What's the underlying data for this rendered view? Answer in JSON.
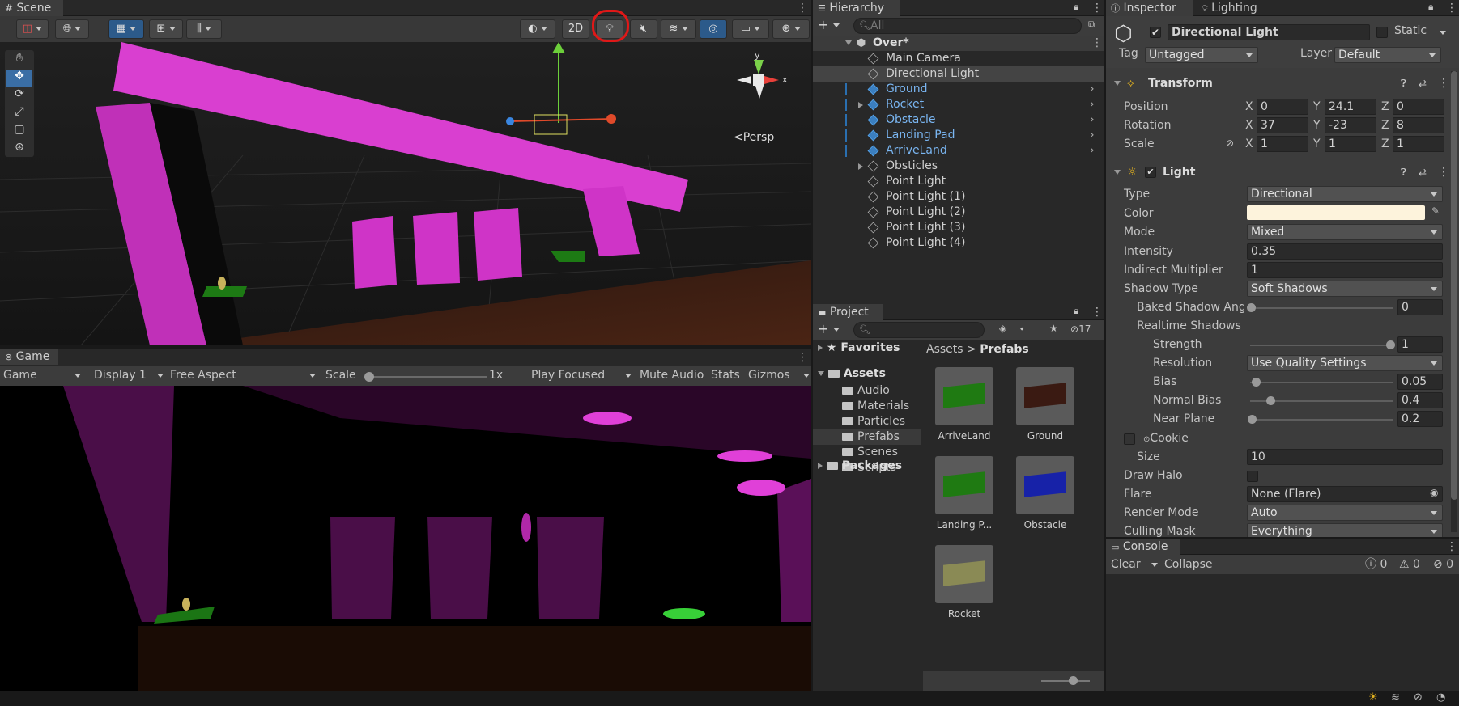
{
  "scene": {
    "tab": "Scene",
    "toolbar": {
      "btn_2d": "2D"
    },
    "gizmo": {
      "y": "y",
      "x": "x",
      "persp": "<Persp"
    }
  },
  "game": {
    "tab": "Game",
    "display_mode": "Game",
    "display": "Display 1",
    "aspect": "Free Aspect",
    "scale_label": "Scale",
    "scale_value": "1x",
    "play_mode": "Play Focused",
    "mute": "Mute Audio",
    "stats": "Stats",
    "gizmos": "Gizmos"
  },
  "hierarchy": {
    "tab": "Hierarchy",
    "search_placeholder": "All",
    "scene_name": "Over*",
    "items": [
      {
        "label": "Main Camera",
        "prefab": false,
        "expandable": false,
        "arrow": false
      },
      {
        "label": "Directional Light",
        "prefab": false,
        "expandable": false,
        "arrow": false,
        "selected": true
      },
      {
        "label": "Ground",
        "prefab": true,
        "expandable": false,
        "arrow": true
      },
      {
        "label": "Rocket",
        "prefab": true,
        "expandable": true,
        "arrow": true
      },
      {
        "label": "Obstacle",
        "prefab": true,
        "expandable": false,
        "arrow": true
      },
      {
        "label": "Landing Pad",
        "prefab": true,
        "expandable": false,
        "arrow": true
      },
      {
        "label": "ArriveLand",
        "prefab": true,
        "expandable": false,
        "arrow": true
      },
      {
        "label": "Obsticles",
        "prefab": false,
        "expandable": true,
        "arrow": false
      },
      {
        "label": "Point Light",
        "prefab": false,
        "expandable": false,
        "arrow": false
      },
      {
        "label": "Point Light (1)",
        "prefab": false,
        "expandable": false,
        "arrow": false
      },
      {
        "label": "Point Light (2)",
        "prefab": false,
        "expandable": false,
        "arrow": false
      },
      {
        "label": "Point Light (3)",
        "prefab": false,
        "expandable": false,
        "arrow": false
      },
      {
        "label": "Point Light (4)",
        "prefab": false,
        "expandable": false,
        "arrow": false
      }
    ]
  },
  "project": {
    "tab": "Project",
    "hidden_count": "17",
    "favorites": "Favorites",
    "assets": "Assets",
    "folders": [
      "Audio",
      "Materials",
      "Particles",
      "Prefabs",
      "Scenes",
      "Scripts"
    ],
    "packages": "Packages",
    "breadcrumb_root": "Assets",
    "breadcrumb_sep": ">",
    "breadcrumb_current": "Prefabs",
    "assets_grid": [
      {
        "label": "ArriveLand",
        "color": "#1f7a12"
      },
      {
        "label": "Ground",
        "color": "#3a1a12"
      },
      {
        "label": "Landing P...",
        "color": "#1f7a12"
      },
      {
        "label": "Obstacle",
        "color": "#1722a8"
      },
      {
        "label": "Rocket",
        "color": "#8a8a55"
      }
    ]
  },
  "inspector": {
    "tab": "Inspector",
    "tab2": "Lighting",
    "object_name": "Directional Light",
    "static_label": "Static",
    "tag_label": "Tag",
    "tag_value": "Untagged",
    "layer_label": "Layer",
    "layer_value": "Default",
    "transform": {
      "title": "Transform",
      "position_label": "Position",
      "rotation_label": "Rotation",
      "scale_label": "Scale",
      "axes": [
        "X",
        "Y",
        "Z"
      ],
      "position": [
        "0",
        "24.1",
        "0"
      ],
      "rotation": [
        "37",
        "-23",
        "8"
      ],
      "scale": [
        "1",
        "1",
        "1"
      ]
    },
    "light": {
      "title": "Light",
      "type_label": "Type",
      "type_value": "Directional",
      "color_label": "Color",
      "color_value": "#fdf3dc",
      "mode_label": "Mode",
      "mode_value": "Mixed",
      "intensity_label": "Intensity",
      "intensity_value": "0.35",
      "indirect_label": "Indirect Multiplier",
      "indirect_value": "1",
      "shadow_type_label": "Shadow Type",
      "shadow_type_value": "Soft Shadows",
      "baked_label": "Baked Shadow Ang",
      "baked_value": "0",
      "realtime_label": "Realtime Shadows",
      "strength_label": "Strength",
      "strength_value": "1",
      "resolution_label": "Resolution",
      "resolution_value": "Use Quality Settings",
      "bias_label": "Bias",
      "bias_value": "0.05",
      "normal_bias_label": "Normal Bias",
      "normal_bias_value": "0.4",
      "near_plane_label": "Near Plane",
      "near_plane_value": "0.2",
      "cookie_label": "Cookie",
      "size_label": "Size",
      "size_value": "10",
      "draw_halo_label": "Draw Halo",
      "flare_label": "Flare",
      "flare_value": "None (Flare)",
      "render_mode_label": "Render Mode",
      "render_mode_value": "Auto",
      "culling_label": "Culling Mask",
      "culling_value": "Everything"
    }
  },
  "console": {
    "tab": "Console",
    "clear": "Clear",
    "collapse": "Collapse",
    "info_count": "0",
    "warn_count": "0",
    "error_count": "0"
  }
}
